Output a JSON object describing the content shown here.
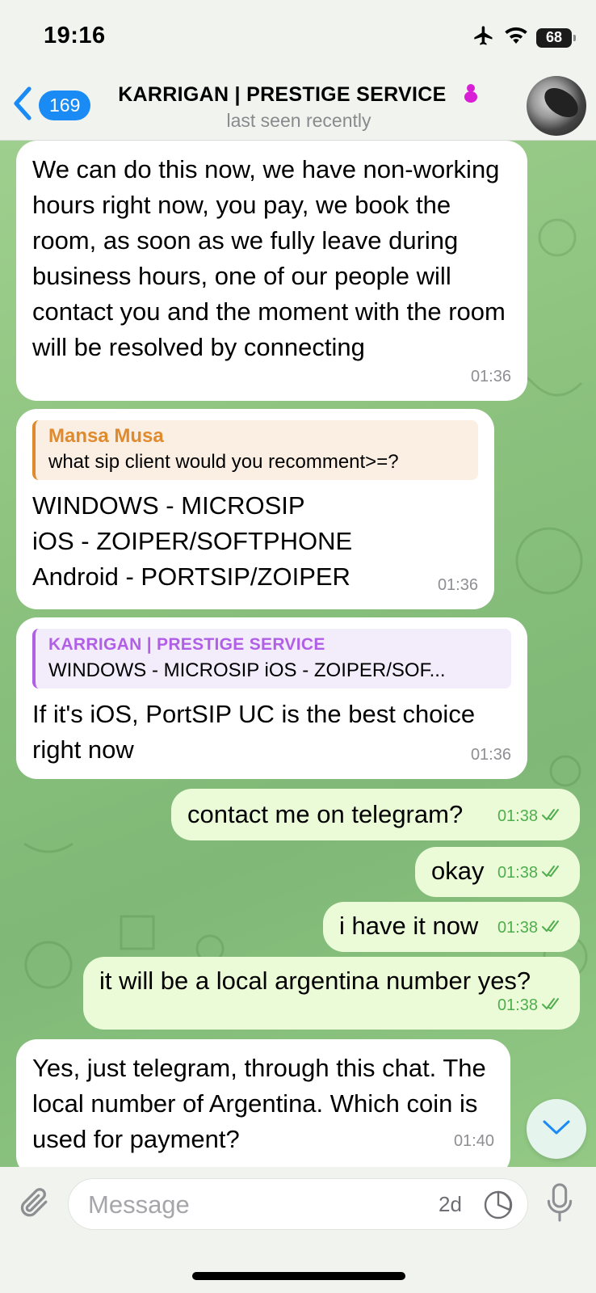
{
  "status_bar": {
    "time": "19:16",
    "battery": "68"
  },
  "header": {
    "back_count": "169",
    "title": "KARRIGAN | PRESTIGE SERVICE",
    "subtitle": "last seen recently"
  },
  "messages": [
    {
      "direction": "incoming",
      "text": "We can do this now, we have non-working hours right now, you pay, we book the room, as soon as we fully leave during business hours, one of our people will contact you and the moment with the room will be resolved by connecting",
      "time": "01:36"
    },
    {
      "direction": "incoming",
      "reply_name": "Mansa Musa",
      "reply_text": "what sip client would you recomment>=?",
      "lines": [
        "WINDOWS - MICROSIP",
        "iOS - ZOIPER/SOFTPHONE",
        "Android - PORTSIP/ZOIPER"
      ],
      "time": "01:36"
    },
    {
      "direction": "incoming",
      "reply_name": "KARRIGAN | PRESTIGE SERVICE",
      "reply_text": "WINDOWS - MICROSIP iOS - ZOIPER/SOF...",
      "text": "If it's iOS, PortSIP UC is the best choice right now",
      "time": "01:36"
    },
    {
      "direction": "outgoing",
      "text": "contact me on telegram?",
      "time": "01:38"
    },
    {
      "direction": "outgoing",
      "text": "okay",
      "time": "01:38"
    },
    {
      "direction": "outgoing",
      "text": "i have it now",
      "time": "01:38"
    },
    {
      "direction": "outgoing",
      "text": "it will be a local argentina number yes?",
      "time": "01:38"
    },
    {
      "direction": "incoming",
      "text": "Yes, just telegram, through this chat. The local number of Argentina. Which coin is used for payment?",
      "time": "01:40"
    }
  ],
  "composer": {
    "placeholder": "Message",
    "timer_label": "2d"
  },
  "colors": {
    "accent": "#1a8af5",
    "incoming_bubble": "#ffffff",
    "outgoing_bubble": "#ebfbd7",
    "read_check": "#4fae4e",
    "reply_orange": "#e08a2e",
    "reply_purple": "#b05fe6"
  }
}
